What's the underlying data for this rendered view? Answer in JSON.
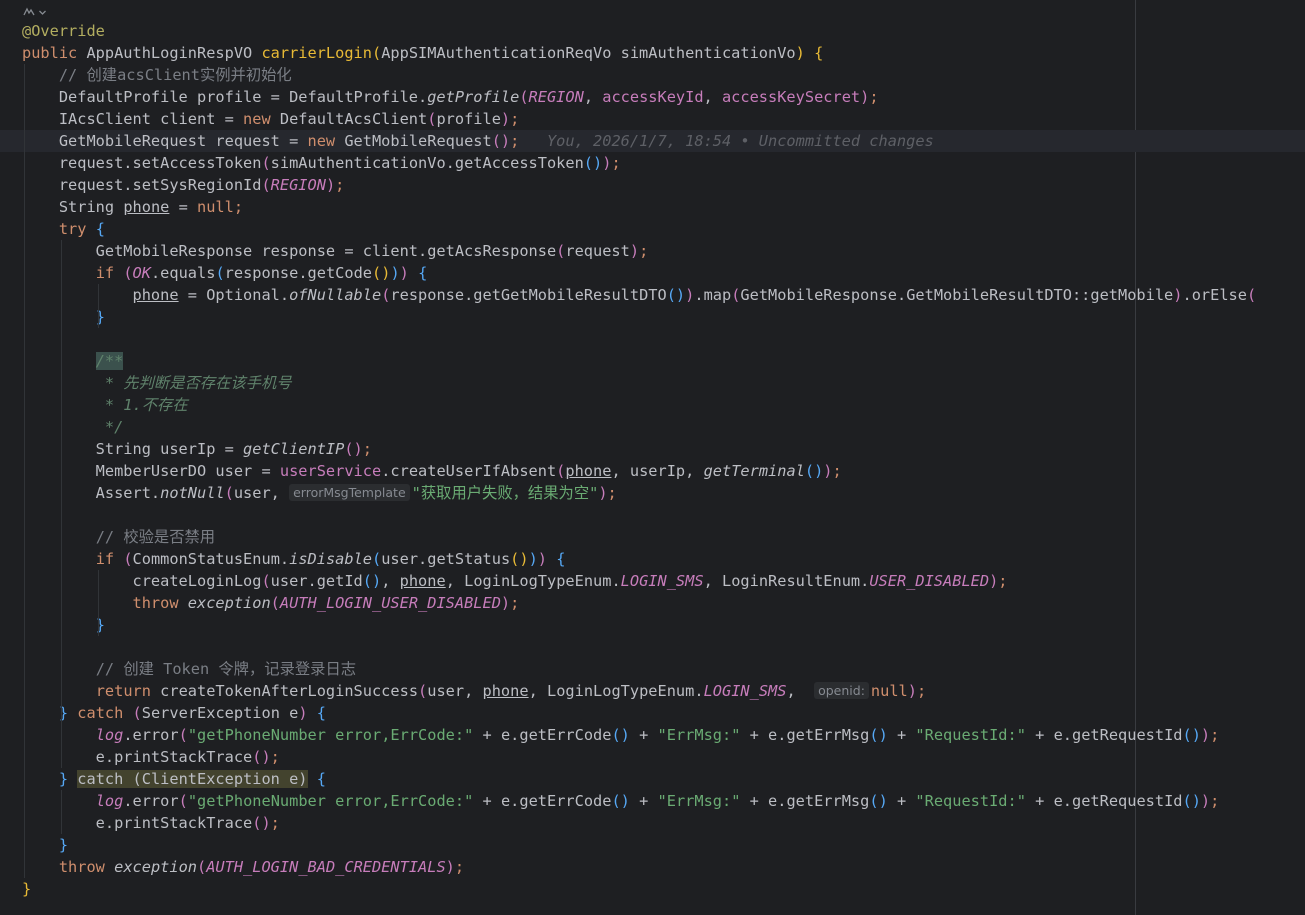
{
  "editor": {
    "gutter_icon": "reader-mode-icon",
    "lines": [
      [
        {
          "t": "@Override",
          "c": "ann"
        }
      ],
      [
        {
          "t": "public ",
          "c": "kw"
        },
        {
          "t": "AppAuthLoginRespVO "
        },
        {
          "t": "carrierLogin",
          "c": "fn-decl"
        },
        {
          "t": "(",
          "c": "paren-y"
        },
        {
          "t": "AppSIMAuthenticationReqVo simAuthenticationVo"
        },
        {
          "t": ")",
          "c": "paren-y"
        },
        {
          "t": " "
        },
        {
          "t": "{",
          "c": "brace-y"
        }
      ],
      [
        {
          "t": "    "
        },
        {
          "t": "// 创建acsClient实例并初始化",
          "c": "cmt"
        }
      ],
      [
        {
          "t": "    DefaultProfile profile = DefaultProfile."
        },
        {
          "t": "getProfile",
          "c": "stmeth"
        },
        {
          "t": "(",
          "c": "paren-p"
        },
        {
          "t": "REGION",
          "c": "static"
        },
        {
          "t": ", "
        },
        {
          "t": "accessKeyId",
          "c": "field"
        },
        {
          "t": ", "
        },
        {
          "t": "accessKeySecret",
          "c": "field"
        },
        {
          "t": ")",
          "c": "paren-p"
        },
        {
          "t": ";",
          "c": "kw"
        }
      ],
      [
        {
          "t": "    IAcsClient client = "
        },
        {
          "t": "new ",
          "c": "kw"
        },
        {
          "t": "DefaultAcsClient"
        },
        {
          "t": "(",
          "c": "paren-p"
        },
        {
          "t": "profile"
        },
        {
          "t": ")",
          "c": "paren-p"
        },
        {
          "t": ";",
          "c": "kw"
        }
      ],
      [
        {
          "t": "    GetMobileRequest request = "
        },
        {
          "t": "new ",
          "c": "kw"
        },
        {
          "t": "GetMobileRequest"
        },
        {
          "t": "()",
          "c": "paren-p"
        },
        {
          "t": ";",
          "c": "kw"
        },
        {
          "t": "   You, 2026/1/7, 18:54 • Uncommitted changes",
          "c": "blame"
        }
      ],
      [
        {
          "t": "    request.setAccessToken"
        },
        {
          "t": "(",
          "c": "paren-p"
        },
        {
          "t": "simAuthenticationVo.getAccessToken"
        },
        {
          "t": "()",
          "c": "paren-b"
        },
        {
          "t": ")",
          "c": "paren-p"
        },
        {
          "t": ";",
          "c": "kw"
        }
      ],
      [
        {
          "t": "    request.setSysRegionId"
        },
        {
          "t": "(",
          "c": "paren-p"
        },
        {
          "t": "REGION",
          "c": "static"
        },
        {
          "t": ")",
          "c": "paren-p"
        },
        {
          "t": ";",
          "c": "kw"
        }
      ],
      [
        {
          "t": "    String "
        },
        {
          "t": "phone",
          "c": "var-u"
        },
        {
          "t": " = "
        },
        {
          "t": "null",
          "c": "kw"
        },
        {
          "t": ";",
          "c": "kw"
        }
      ],
      [
        {
          "t": "    "
        },
        {
          "t": "try ",
          "c": "kw"
        },
        {
          "t": "{",
          "c": "brace-b"
        }
      ],
      [
        {
          "t": "        GetMobileResponse response = client.getAcsResponse"
        },
        {
          "t": "(",
          "c": "paren-p"
        },
        {
          "t": "request"
        },
        {
          "t": ")",
          "c": "paren-p"
        },
        {
          "t": ";",
          "c": "kw"
        }
      ],
      [
        {
          "t": "        "
        },
        {
          "t": "if ",
          "c": "kw"
        },
        {
          "t": "(",
          "c": "paren-p"
        },
        {
          "t": "OK",
          "c": "static"
        },
        {
          "t": ".equals"
        },
        {
          "t": "(",
          "c": "paren-b"
        },
        {
          "t": "response.getCode"
        },
        {
          "t": "()",
          "c": "paren-y"
        },
        {
          "t": ")",
          "c": "paren-b"
        },
        {
          "t": ")",
          "c": "paren-p"
        },
        {
          "t": " "
        },
        {
          "t": "{",
          "c": "brace-b"
        }
      ],
      [
        {
          "t": "            "
        },
        {
          "t": "phone",
          "c": "var-u"
        },
        {
          "t": " = Optional."
        },
        {
          "t": "ofNullable",
          "c": "stmeth"
        },
        {
          "t": "(",
          "c": "paren-p"
        },
        {
          "t": "response.getGetMobileResultDTO"
        },
        {
          "t": "()",
          "c": "paren-b"
        },
        {
          "t": ")",
          "c": "paren-p"
        },
        {
          "t": ".map"
        },
        {
          "t": "(",
          "c": "paren-p"
        },
        {
          "t": "GetMobileResponse.GetMobileResultDTO::getMobile"
        },
        {
          "t": ")",
          "c": "paren-p"
        },
        {
          "t": ".orElse"
        },
        {
          "t": "(",
          "c": "paren-p"
        }
      ],
      [
        {
          "t": "        "
        },
        {
          "t": "}",
          "c": "brace-b"
        }
      ],
      [
        {
          "t": ""
        }
      ],
      [
        {
          "t": "        "
        },
        {
          "t": "/**",
          "c": "doc-open"
        }
      ],
      [
        {
          "t": "         "
        },
        {
          "t": "* 先判断是否存在该手机号",
          "c": "doc"
        }
      ],
      [
        {
          "t": "         "
        },
        {
          "t": "* 1.不存在",
          "c": "doc"
        }
      ],
      [
        {
          "t": "         "
        },
        {
          "t": "*/",
          "c": "doc"
        }
      ],
      [
        {
          "t": "        String userIp = "
        },
        {
          "t": "getClientIP",
          "c": "stmeth"
        },
        {
          "t": "()",
          "c": "paren-p"
        },
        {
          "t": ";",
          "c": "kw"
        }
      ],
      [
        {
          "t": "        MemberUserDO user = "
        },
        {
          "t": "userService",
          "c": "field"
        },
        {
          "t": ".createUserIfAbsent"
        },
        {
          "t": "(",
          "c": "paren-p"
        },
        {
          "t": "phone",
          "c": "var-u"
        },
        {
          "t": ", userIp, "
        },
        {
          "t": "getTerminal",
          "c": "stmeth"
        },
        {
          "t": "()",
          "c": "paren-b"
        },
        {
          "t": ")",
          "c": "paren-p"
        },
        {
          "t": ";",
          "c": "kw"
        }
      ],
      [
        {
          "t": "        Assert."
        },
        {
          "t": "notNull",
          "c": "stmeth"
        },
        {
          "t": "(",
          "c": "paren-p"
        },
        {
          "t": "user, "
        },
        {
          "t": "errorMsgTemplate",
          "c": "hint"
        },
        {
          "t": "\"获取用户失败，结果为空\"",
          "c": "str"
        },
        {
          "t": ")",
          "c": "paren-p"
        },
        {
          "t": ";",
          "c": "kw"
        }
      ],
      [
        {
          "t": ""
        }
      ],
      [
        {
          "t": "        "
        },
        {
          "t": "// 校验是否禁用",
          "c": "cmt"
        }
      ],
      [
        {
          "t": "        "
        },
        {
          "t": "if ",
          "c": "kw"
        },
        {
          "t": "(",
          "c": "paren-p"
        },
        {
          "t": "CommonStatusEnum."
        },
        {
          "t": "isDisable",
          "c": "stmeth"
        },
        {
          "t": "(",
          "c": "paren-b"
        },
        {
          "t": "user.getStatus"
        },
        {
          "t": "()",
          "c": "paren-y"
        },
        {
          "t": ")",
          "c": "paren-b"
        },
        {
          "t": ")",
          "c": "paren-p"
        },
        {
          "t": " "
        },
        {
          "t": "{",
          "c": "brace-b"
        }
      ],
      [
        {
          "t": "            createLoginLog"
        },
        {
          "t": "(",
          "c": "paren-p"
        },
        {
          "t": "user.getId"
        },
        {
          "t": "()",
          "c": "paren-b"
        },
        {
          "t": ", "
        },
        {
          "t": "phone",
          "c": "var-u"
        },
        {
          "t": ", LoginLogTypeEnum."
        },
        {
          "t": "LOGIN_SMS",
          "c": "static"
        },
        {
          "t": ", LoginResultEnum."
        },
        {
          "t": "USER_DISABLED",
          "c": "static"
        },
        {
          "t": ")",
          "c": "paren-p"
        },
        {
          "t": ";",
          "c": "kw"
        }
      ],
      [
        {
          "t": "            "
        },
        {
          "t": "throw ",
          "c": "kw"
        },
        {
          "t": "exception",
          "c": "stmeth"
        },
        {
          "t": "(",
          "c": "paren-p"
        },
        {
          "t": "AUTH_LOGIN_USER_DISABLED",
          "c": "static"
        },
        {
          "t": ")",
          "c": "paren-p"
        },
        {
          "t": ";",
          "c": "kw"
        }
      ],
      [
        {
          "t": "        "
        },
        {
          "t": "}",
          "c": "brace-b"
        }
      ],
      [
        {
          "t": ""
        }
      ],
      [
        {
          "t": "        "
        },
        {
          "t": "// 创建 Token 令牌，记录登录日志",
          "c": "cmt"
        }
      ],
      [
        {
          "t": "        "
        },
        {
          "t": "return ",
          "c": "kw"
        },
        {
          "t": "createTokenAfterLoginSuccess"
        },
        {
          "t": "(",
          "c": "paren-p"
        },
        {
          "t": "user, "
        },
        {
          "t": "phone",
          "c": "var-u"
        },
        {
          "t": ", LoginLogTypeEnum."
        },
        {
          "t": "LOGIN_SMS",
          "c": "static"
        },
        {
          "t": ",  "
        },
        {
          "t": "openid:",
          "c": "hint"
        },
        {
          "t": "null",
          "c": "kw"
        },
        {
          "t": ")",
          "c": "paren-p"
        },
        {
          "t": ";",
          "c": "kw"
        }
      ],
      [
        {
          "t": "    "
        },
        {
          "t": "}",
          "c": "brace-b"
        },
        {
          "t": " "
        },
        {
          "t": "catch ",
          "c": "kw"
        },
        {
          "t": "(",
          "c": "paren-p"
        },
        {
          "t": "ServerException e"
        },
        {
          "t": ")",
          "c": "paren-p"
        },
        {
          "t": " "
        },
        {
          "t": "{",
          "c": "brace-b"
        }
      ],
      [
        {
          "t": "        "
        },
        {
          "t": "log",
          "c": "static"
        },
        {
          "t": ".error"
        },
        {
          "t": "(",
          "c": "paren-p"
        },
        {
          "t": "\"getPhoneNumber error,ErrCode:\"",
          "c": "str"
        },
        {
          "t": " + e.getErrCode"
        },
        {
          "t": "()",
          "c": "paren-b"
        },
        {
          "t": " + "
        },
        {
          "t": "\"ErrMsg:\"",
          "c": "str"
        },
        {
          "t": " + e.getErrMsg"
        },
        {
          "t": "()",
          "c": "paren-b"
        },
        {
          "t": " + "
        },
        {
          "t": "\"RequestId:\"",
          "c": "str"
        },
        {
          "t": " + e.getRequestId"
        },
        {
          "t": "()",
          "c": "paren-b"
        },
        {
          "t": ")",
          "c": "paren-p"
        },
        {
          "t": ";",
          "c": "kw"
        }
      ],
      [
        {
          "t": "        e.printStackTrace"
        },
        {
          "t": "()",
          "c": "paren-p"
        },
        {
          "t": ";",
          "c": "kw"
        }
      ],
      [
        {
          "t": "    "
        },
        {
          "t": "}",
          "c": "brace-b"
        },
        {
          "t": " "
        },
        {
          "t": "catch (ClientException e)",
          "c": "catch-hl"
        },
        {
          "t": " "
        },
        {
          "t": "{",
          "c": "brace-b"
        }
      ],
      [
        {
          "t": "        "
        },
        {
          "t": "log",
          "c": "static"
        },
        {
          "t": ".error"
        },
        {
          "t": "(",
          "c": "paren-p"
        },
        {
          "t": "\"getPhoneNumber error,ErrCode:\"",
          "c": "str"
        },
        {
          "t": " + e.getErrCode"
        },
        {
          "t": "()",
          "c": "paren-b"
        },
        {
          "t": " + "
        },
        {
          "t": "\"ErrMsg:\"",
          "c": "str"
        },
        {
          "t": " + e.getErrMsg"
        },
        {
          "t": "()",
          "c": "paren-b"
        },
        {
          "t": " + "
        },
        {
          "t": "\"RequestId:\"",
          "c": "str"
        },
        {
          "t": " + e.getRequestId"
        },
        {
          "t": "()",
          "c": "paren-b"
        },
        {
          "t": ")",
          "c": "paren-p"
        },
        {
          "t": ";",
          "c": "kw"
        }
      ],
      [
        {
          "t": "        e.printStackTrace"
        },
        {
          "t": "()",
          "c": "paren-p"
        },
        {
          "t": ";",
          "c": "kw"
        }
      ],
      [
        {
          "t": "    "
        },
        {
          "t": "}",
          "c": "brace-b"
        }
      ],
      [
        {
          "t": "    "
        },
        {
          "t": "throw ",
          "c": "kw"
        },
        {
          "t": "exception",
          "c": "stmeth"
        },
        {
          "t": "(",
          "c": "paren-p"
        },
        {
          "t": "AUTH_LOGIN_BAD_CREDENTIALS",
          "c": "static"
        },
        {
          "t": ")",
          "c": "paren-p"
        },
        {
          "t": ";",
          "c": "kw"
        }
      ],
      [
        {
          "t": "}",
          "c": "brace-y"
        }
      ]
    ],
    "current_line": 5,
    "colors": {
      "background": "#1e1f22",
      "keyword": "#cf8e6d",
      "function_decl": "#e8ba36",
      "string": "#6aab73",
      "static_field": "#c77dbb",
      "comment": "#7a7e85",
      "doc_comment": "#5f826b",
      "default_text": "#bcbec4"
    }
  }
}
